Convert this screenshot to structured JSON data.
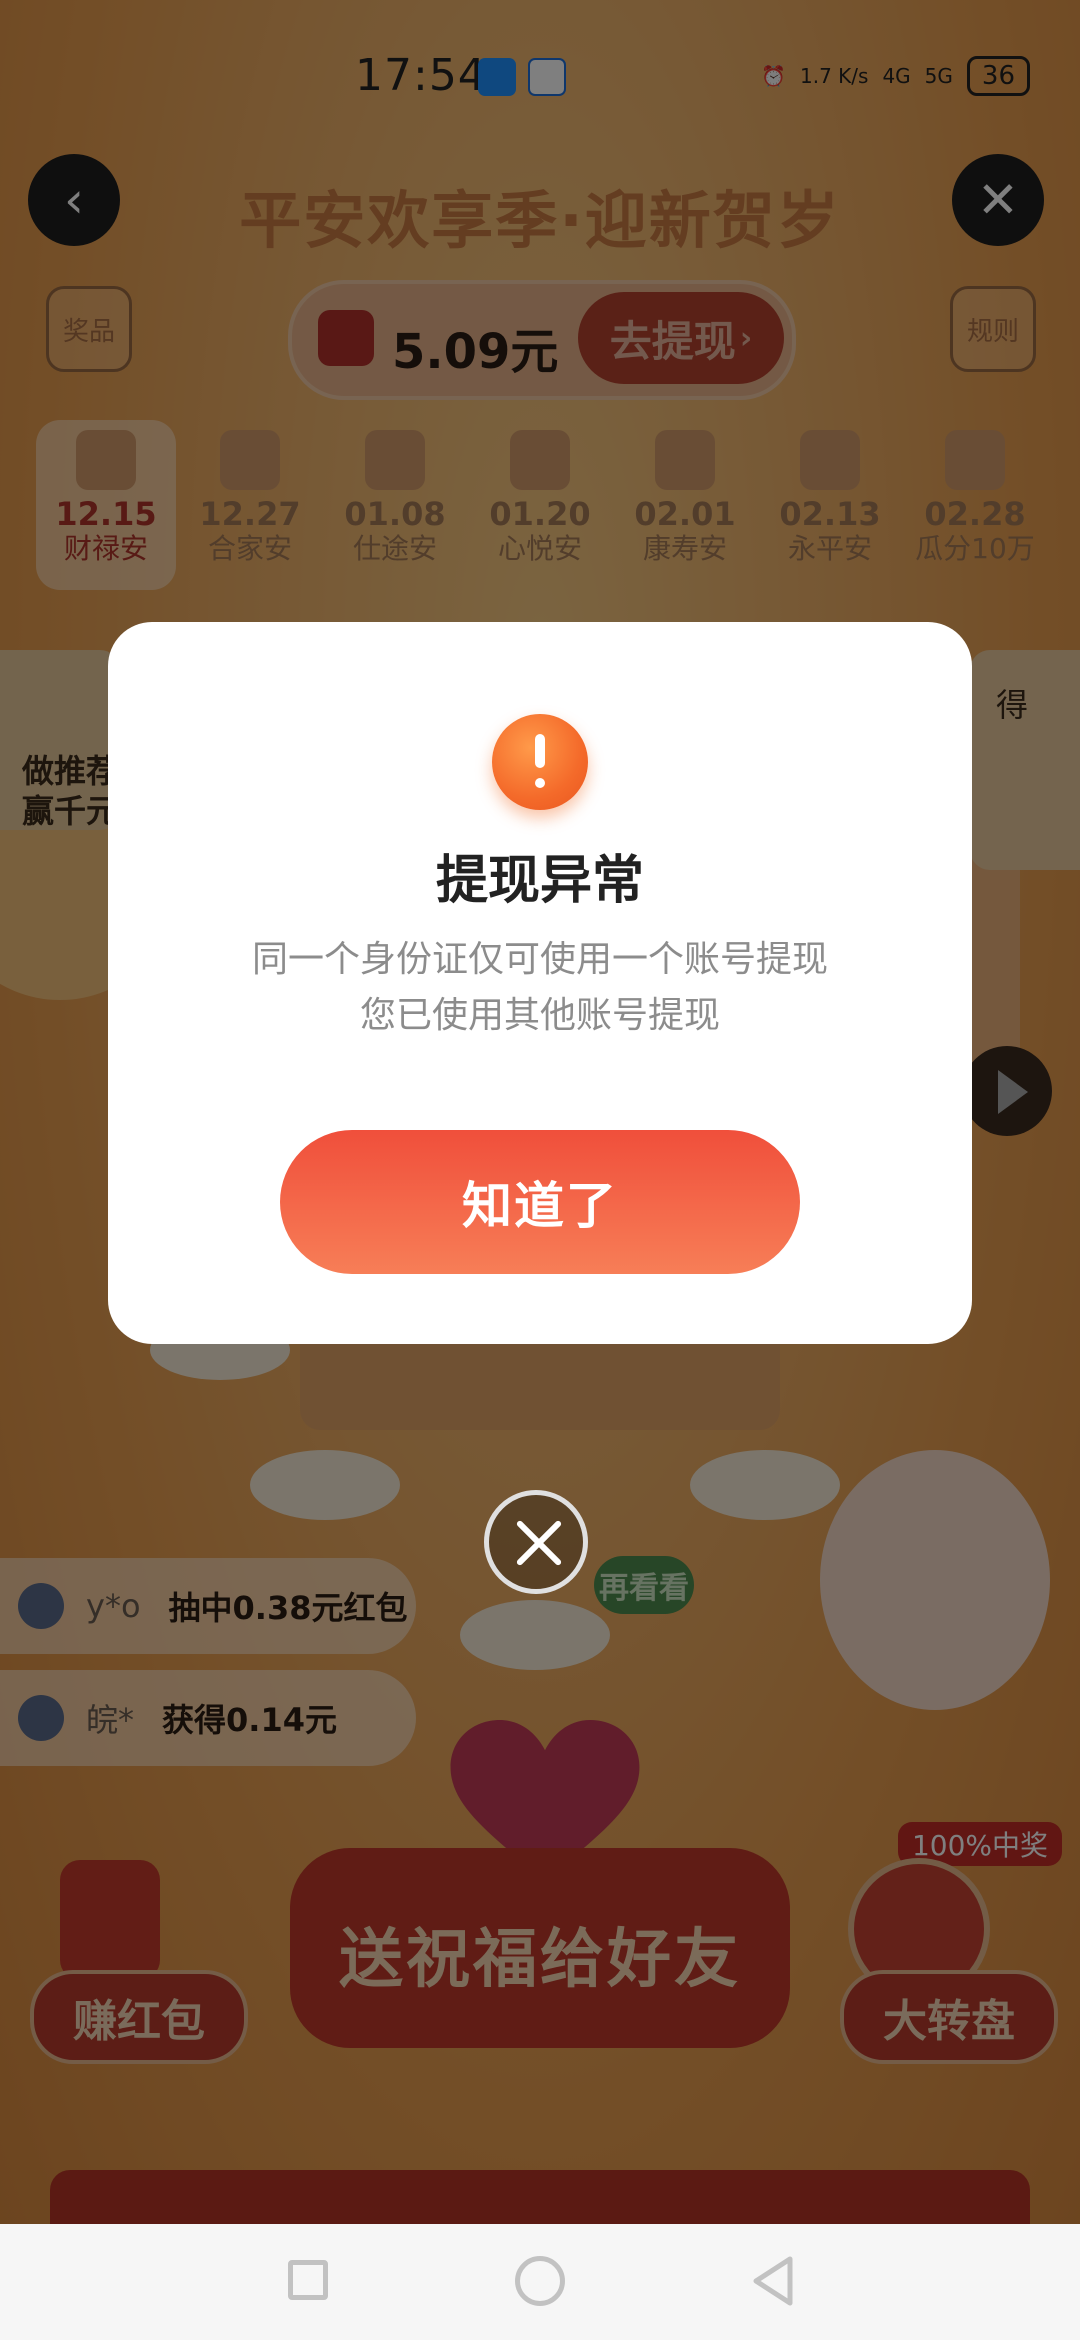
{
  "status_bar": {
    "time": "17:54",
    "net_speed": "1.7 K/s",
    "network_1": "4G",
    "network_2": "5G",
    "battery": "36"
  },
  "header": {
    "back_icon": "chevron-left-icon",
    "close_icon": "close-icon",
    "title": "平安欢享季·迎新贺岁",
    "prizes_label": "奖品",
    "rules_label": "规则"
  },
  "balance": {
    "amount": "5.09元",
    "withdraw_label": "去提现"
  },
  "date_tabs": [
    {
      "date": "12.15",
      "name": "财禄安"
    },
    {
      "date": "12.27",
      "name": "合家安"
    },
    {
      "date": "01.08",
      "name": "仕途安"
    },
    {
      "date": "01.20",
      "name": "心悦安"
    },
    {
      "date": "02.01",
      "name": "康寿安"
    },
    {
      "date": "02.13",
      "name": "永平安"
    },
    {
      "date": "02.28",
      "name": "瓜分10万"
    }
  ],
  "left_card": {
    "line1": "做推荐",
    "line2": "赢千元"
  },
  "right_card": {
    "text": "得"
  },
  "tickers": [
    {
      "user": "y*o",
      "message": "抽中0.38元红包"
    },
    {
      "user": "皖*",
      "message": "获得0.14元"
    }
  ],
  "again_label": "再看看",
  "actions": {
    "earn_red_packet": "赚红包",
    "send_blessing": "送祝福给好友",
    "big_wheel": "大转盘",
    "wheel_badge": "100%中奖"
  },
  "dialog": {
    "icon": "warning-icon",
    "title": "提现异常",
    "message_line1": "同一个身份证仅可使用一个账号提现",
    "message_line2": "您已使用其他账号提现",
    "ok_button": "知道了"
  },
  "colors": {
    "accent": "#f05a3e",
    "dialog_bg": "#ffffff",
    "message_gray": "#8c8c8c"
  }
}
